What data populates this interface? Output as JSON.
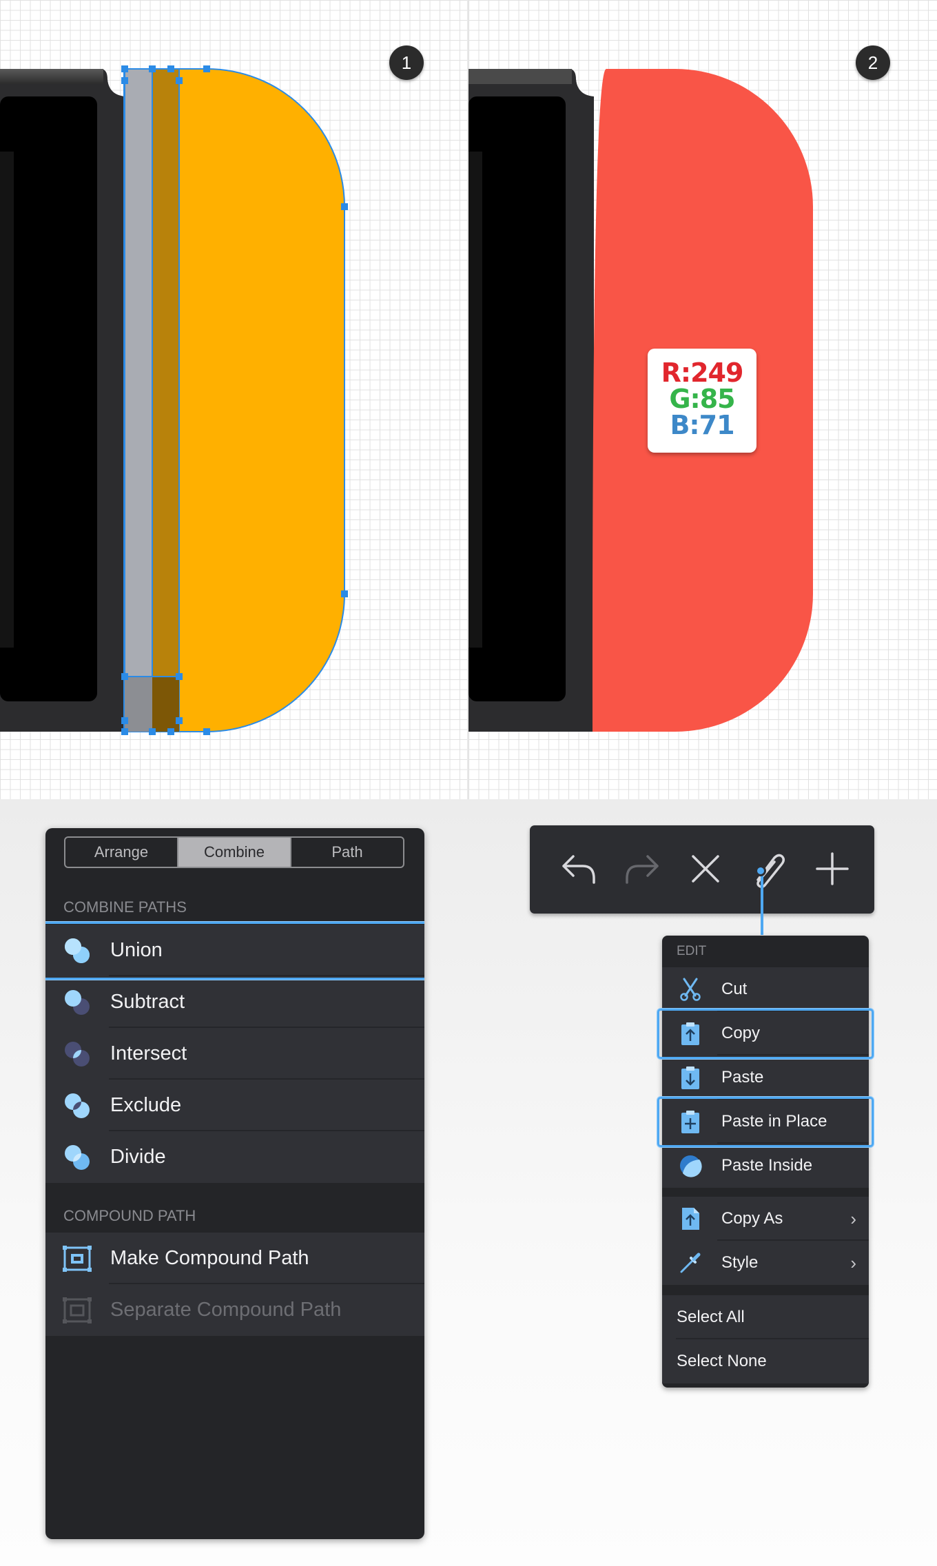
{
  "canvas": {
    "step1_badge": "1",
    "step2_badge": "2",
    "fill_color_1": "#ffb000",
    "fill_color_2": "#f95547",
    "color_readout": {
      "r": "R:249",
      "g": "G:85",
      "b": "B:71"
    }
  },
  "combine_panel": {
    "tabs": [
      {
        "label": "Arrange",
        "active": false
      },
      {
        "label": "Combine",
        "active": true
      },
      {
        "label": "Path",
        "active": false
      }
    ],
    "section_combine": "COMBINE PATHS",
    "combine_items": [
      {
        "label": "Union",
        "icon": "union-icon",
        "selected": true
      },
      {
        "label": "Subtract",
        "icon": "subtract-icon"
      },
      {
        "label": "Intersect",
        "icon": "intersect-icon"
      },
      {
        "label": "Exclude",
        "icon": "exclude-icon"
      },
      {
        "label": "Divide",
        "icon": "divide-icon"
      }
    ],
    "section_compound": "COMPOUND PATH",
    "compound_items": [
      {
        "label": "Make Compound Path",
        "icon": "make-compound-path-icon",
        "enabled": true
      },
      {
        "label": "Separate Compound Path",
        "icon": "separate-compound-path-icon",
        "enabled": false
      }
    ]
  },
  "toolbar": {
    "buttons": [
      "undo-icon",
      "redo-icon",
      "close-icon",
      "paperclip-icon",
      "plus-icon"
    ]
  },
  "edit_menu": {
    "header": "EDIT",
    "items": [
      {
        "label": "Cut",
        "icon": "scissors-icon"
      },
      {
        "label": "Copy",
        "icon": "clipboard-copy-icon",
        "selected": true
      },
      {
        "label": "Paste",
        "icon": "clipboard-paste-icon"
      },
      {
        "label": "Paste in Place",
        "icon": "clipboard-paste-in-place-icon",
        "selected": true
      },
      {
        "label": "Paste Inside",
        "icon": "paste-inside-icon"
      }
    ],
    "submenu_items": [
      {
        "label": "Copy As",
        "icon": "document-copy-as-icon",
        "chevron": "›"
      },
      {
        "label": "Style",
        "icon": "eyedropper-icon",
        "chevron": "›"
      }
    ],
    "select_items": [
      {
        "label": "Select All"
      },
      {
        "label": "Select None"
      }
    ]
  },
  "colors": {
    "accent": "#4ea8f2",
    "panel_bg": "#242528",
    "row_bg": "#303136"
  }
}
